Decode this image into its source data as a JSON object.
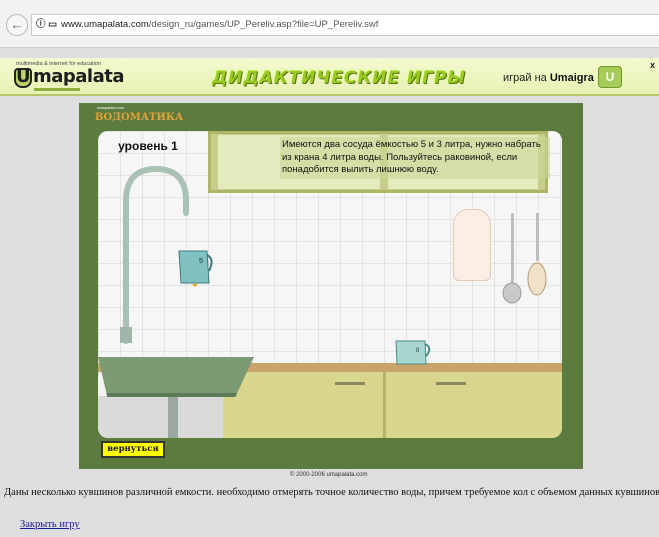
{
  "browser": {
    "back_icon": "back-arrow-icon",
    "url_domain": "www.umapalata.com",
    "url_path": "/design_ru/games/UP_Pereliv.asp?file=UP_Pereliv.swf",
    "info_icon": "info-icon"
  },
  "banner": {
    "tagline": "multimedia & internet for education",
    "logo_letter": "U",
    "logo_text": "mapalata",
    "title": "ДИДАКТИЧЕСКИЕ ИГРЫ",
    "play_text": "играй на",
    "play_brand": "Umaigra",
    "badge_letter": "U",
    "close": "x"
  },
  "game": {
    "brand_small": "umapalata.com",
    "brand": "ВОДОМАТИКА",
    "level": "уровень 1",
    "instruction": "Имеются два сосуда ёмкостью 5 и 3 литра, нужно набрать из крана 4 литра воды. Пользуйтесь раковиной, если понадобится вылить лишнюю воду.",
    "jug_large_amount": "5",
    "jug_small_amount": "0",
    "back_button": "вернуться",
    "copyright": "© 2000-2006 umapalata.com"
  },
  "page": {
    "description": "Даны несколько кувшинов различной емкости. необходимо отмерять точное количество воды, причем требуемое кол с объемом данных кувшинов",
    "close_link": "Закрыть игру"
  },
  "colors": {
    "game_frame": "#5c7b3f",
    "title_green": "#9acb25",
    "button_yellow": "#ffff00",
    "link_blue": "#1a1a9c"
  }
}
